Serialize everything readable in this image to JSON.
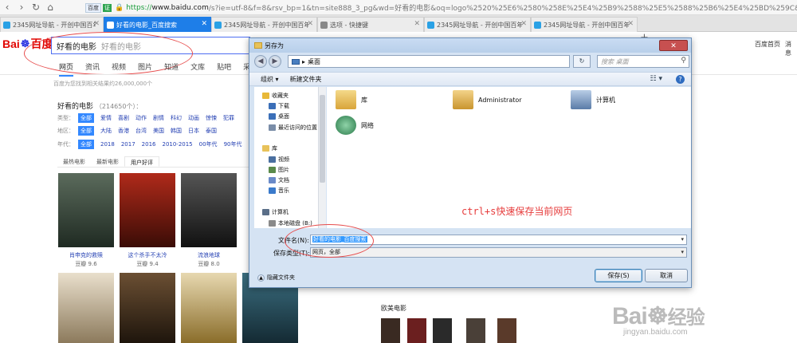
{
  "browser": {
    "nav": {
      "back": "‹",
      "forward": "›",
      "reload": "↻",
      "home": "⌂"
    },
    "address": {
      "badge_bd": "百度",
      "badge_zheng": "证",
      "scheme": "https://",
      "host": "www.baidu.com",
      "path": "/s?ie=utf-8&f=8&rsv_bp=1&tn=site888_3_pg&wd=好看的电影&oq=logo%2520%25E6%2580%258E%25E4%25B9%2588%25E5%2588%25B6%25E4%25BD%259C&rsv_pq"
    },
    "tabs": [
      {
        "title": "2345网址导航 - 开创中国百年品",
        "active": false,
        "icon_color": "#2aa1e5"
      },
      {
        "title": "好看的电影_百度搜索",
        "active": true,
        "icon_color": "#ffffff"
      },
      {
        "title": "2345网址导航 - 开创中国百年品",
        "active": false,
        "icon_color": "#2aa1e5"
      },
      {
        "title": "选项 - 快捷键",
        "active": false,
        "icon_color": "#888888"
      },
      {
        "title": "2345网址导航 - 开创中国百年品",
        "active": false,
        "icon_color": "#2aa1e5"
      },
      {
        "title": "2345网址导航 - 开创中国百年品",
        "active": false,
        "icon_color": "#2aa1e5"
      }
    ],
    "new_tab": "+"
  },
  "baidu": {
    "logo": {
      "bai": "Bai",
      "paw": "☸",
      "du": "百度"
    },
    "query": "好看的电影",
    "query_hint": "好看的电影",
    "top_links": {
      "home": "百度首页",
      "more": "消息"
    },
    "nav_tabs": [
      "网页",
      "资讯",
      "视频",
      "图片",
      "知道",
      "文库",
      "贴吧",
      "采购"
    ],
    "result_count": "百度为您找到相关结果约26,000,000个",
    "movie_title": "好看的电影",
    "movie_count": "（214650个）：",
    "filters": [
      {
        "label": "类型：",
        "items": [
          "全部",
          "爱情",
          "喜剧",
          "动作",
          "剧情",
          "科幻",
          "动画",
          "惊悚",
          "犯罪"
        ]
      },
      {
        "label": "地区：",
        "items": [
          "全部",
          "大陆",
          "香港",
          "台湾",
          "美国",
          "韩国",
          "日本",
          "泰国"
        ]
      },
      {
        "label": "年代：",
        "items": [
          "全部",
          "2018",
          "2017",
          "2016",
          "2010-2015",
          "00年代",
          "90年代"
        ]
      }
    ],
    "subtabs": [
      "最热电影",
      "最新电影",
      "用户好评"
    ],
    "movies": [
      {
        "name": "肖申克的救赎",
        "score": "豆瓣 9.6",
        "color": "#3b4a3d"
      },
      {
        "name": "这个杀手不太冷",
        "score": "豆瓣 9.4",
        "color": "#7a1e12"
      },
      {
        "name": "流浪地球",
        "score": "豆瓣 8.0",
        "color": "#222222"
      }
    ],
    "posters_row2": [
      "#c9b79a",
      "#3a2b1c",
      "#b09040",
      "#2d4a5a"
    ],
    "western_title": "欧美电影",
    "western_posters": [
      "#3a2a22",
      "#6b1f1f",
      "#2a2a2a",
      "#4a4038",
      "#5a3a2a"
    ]
  },
  "dialog": {
    "title": "另存为",
    "close": "✕",
    "path": "桌面",
    "path_arrow": "▸",
    "search_placeholder": "搜索 桌面",
    "toolbar": {
      "organize": "组织 ▾",
      "new_folder": "新建文件夹",
      "view": "☷ ▾",
      "help": "?"
    },
    "left_nav": [
      {
        "label": "收藏夹",
        "color": "#e8b838"
      },
      {
        "label": "下载",
        "color": "#3b6fb8"
      },
      {
        "label": "桌面",
        "color": "#3b6fb8"
      },
      {
        "label": "最近访问的位置",
        "color": "#7a8da8"
      },
      {
        "label": "库",
        "color": "#e8c25a"
      },
      {
        "label": "视频",
        "color": "#4a6fa0"
      },
      {
        "label": "图片",
        "color": "#5a8a4a"
      },
      {
        "label": "文档",
        "color": "#6a8ac8"
      },
      {
        "label": "音乐",
        "color": "#3a7acb"
      },
      {
        "label": "计算机",
        "color": "#5a6e88"
      },
      {
        "label": "本地磁盘 (B:)",
        "color": "#8a8a8a"
      }
    ],
    "items": [
      {
        "label": "库",
        "color": "#e8c25a"
      },
      {
        "label": "Administrator",
        "color": "#d9a53a"
      },
      {
        "label": "计算机",
        "color": "#6a8bb5"
      },
      {
        "label": "网络",
        "color": "#3a8a5a"
      }
    ],
    "annotation": "ctrl+s快速保存当前网页",
    "filename_label": "文件名(N):",
    "filename_value": "好看的电影_百度搜索",
    "filetype_label": "保存类型(T):",
    "filetype_value": "网页，全部",
    "dropdown_arrow": "▾",
    "hide_folders": "隐藏文件夹",
    "save": "保存(S)",
    "cancel": "取消"
  },
  "watermark": {
    "brand": "Bai",
    "brand2": "经验",
    "url": "jingyan.baidu.com"
  },
  "colors": {
    "accent": "#1e7ee8",
    "annotation_red": "#e63b3b",
    "baidu_red": "#e10602",
    "baidu_blue": "#2932e1"
  }
}
